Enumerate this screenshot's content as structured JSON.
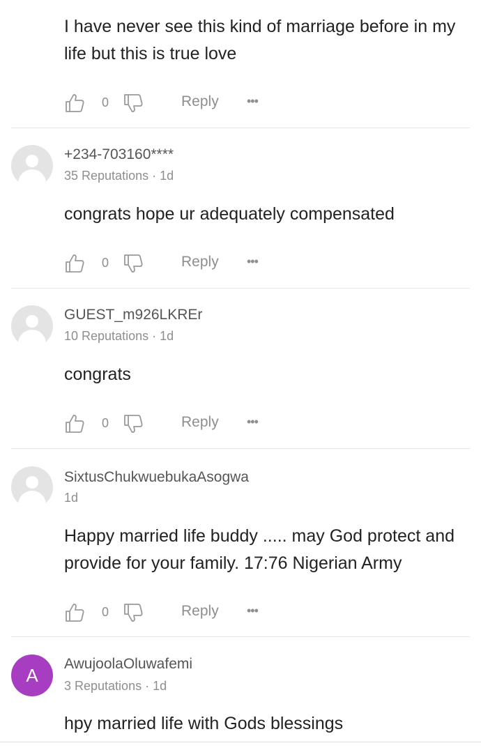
{
  "comments": [
    {
      "username": "",
      "meta": "",
      "text": "I have never see this kind of marriage before in my life but this is true love",
      "likes": "0",
      "reply_label": "Reply",
      "more_label": "•••"
    },
    {
      "username": "+234-703160****",
      "meta": "35 Reputations · 1d",
      "text": "congrats hope ur adequately compensated",
      "likes": "0",
      "reply_label": "Reply",
      "more_label": "•••"
    },
    {
      "username": "GUEST_m926LKREr",
      "meta": "10 Reputations · 1d",
      "text": "congrats",
      "likes": "0",
      "reply_label": "Reply",
      "more_label": "•••"
    },
    {
      "username": "SixtusChukwuebukaAsogwa",
      "meta": "1d",
      "text": "Happy married life buddy ..... may God protect and provide for your family. 17:76 Nigerian Army",
      "likes": "0",
      "reply_label": "Reply",
      "more_label": "•••"
    },
    {
      "username": "AwujoolaOluwafemi",
      "avatar_letter": "A",
      "meta": "3 Reputations · 1d",
      "text": "hpy married life with Gods blessings"
    }
  ],
  "colors": {
    "avatar_letter_bg": "#a73ec2",
    "icon_gray": "#9a9a9a"
  },
  "icons": [
    "thumbs-up-icon",
    "thumbs-down-icon",
    "more-dots-icon",
    "default-avatar-icon"
  ]
}
